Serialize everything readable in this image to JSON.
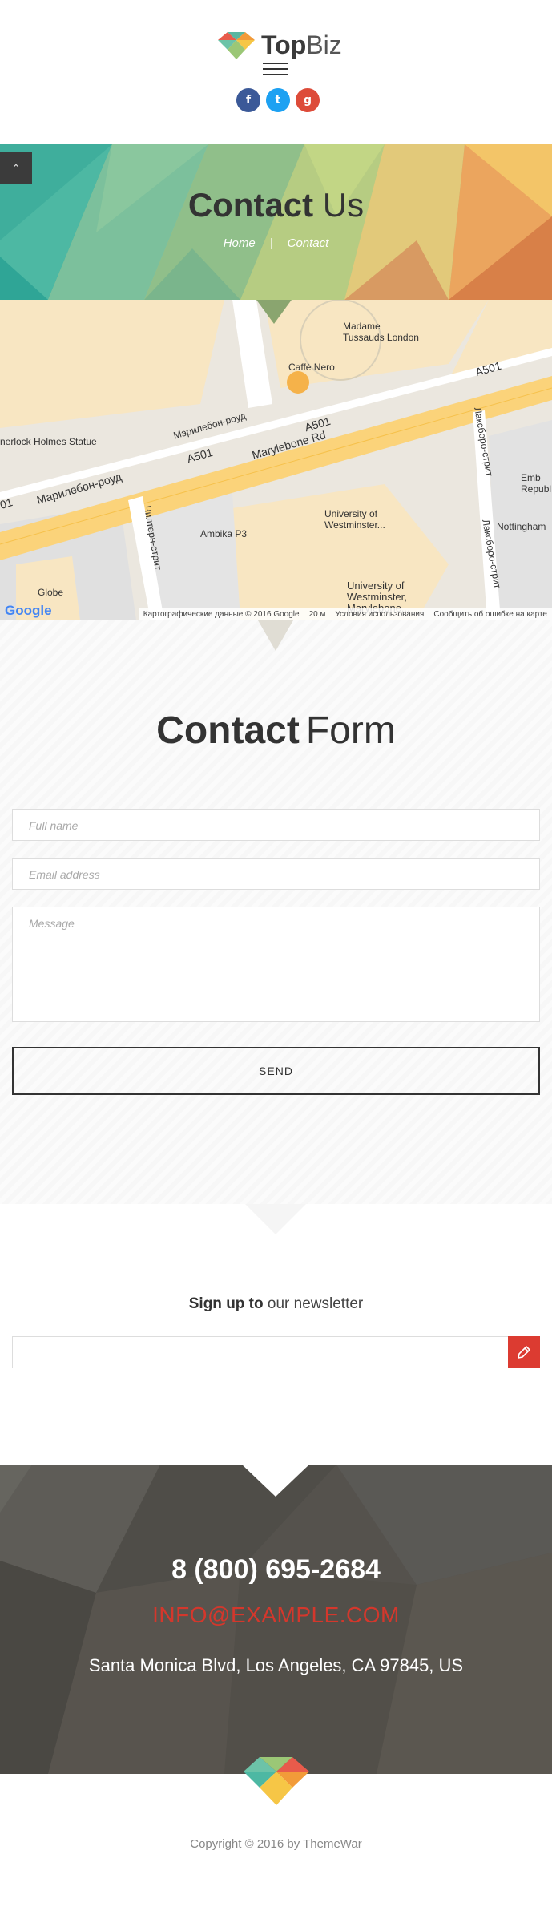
{
  "header": {
    "logo_bold": "Top",
    "logo_light": "Biz",
    "menu_icon": "hamburger-icon",
    "socials": [
      {
        "name": "facebook",
        "glyph": "f",
        "color": "#3b5998"
      },
      {
        "name": "twitter",
        "glyph": "t",
        "color": "#1da1f2"
      },
      {
        "name": "google-plus",
        "glyph": "g",
        "color": "#dd4b39"
      }
    ]
  },
  "hero": {
    "back_to_top_glyph": "⌃",
    "title_bold": "Contact",
    "title_light": "Us",
    "breadcrumb": {
      "home": "Home",
      "separator": "|",
      "current": "Contact"
    }
  },
  "map": {
    "labels": {
      "tussauds": "Madame Tussauds London",
      "caffe": "Caffè Nero",
      "marylebone_road_ru": "Мэрилебон-роуд",
      "a501_1": "A501",
      "a501_2": "A501",
      "a501_3": "A501",
      "a501_4": "01",
      "marylebone_rd": "Marylebone Rd",
      "marylebone_road_ru2": "Марилебон-роуд",
      "holmes": "nerlock Holmes Statue",
      "chiltern": "Чилтерн-стрит",
      "ambika": "Ambika P3",
      "uow1": "University of Westminster...",
      "uow2": "University of Westminster, Marylebone...",
      "luxborough": "Лаксборо-стрит",
      "luxborough2": "Лаксборо-стрит",
      "nottingham": "Nottingham",
      "embassy": "Emb Republ",
      "globe": "Globe"
    },
    "google": "Google",
    "attribution": "Картографические данные © 2016 Google",
    "scale": "20 м",
    "terms": "Условия использования",
    "report": "Сообщить об ошибке на карте"
  },
  "form": {
    "title_bold": "Contact",
    "title_light": "Form",
    "name_placeholder": "Full name",
    "email_placeholder": "Email address",
    "message_placeholder": "Message",
    "send_label": "SEND"
  },
  "newsletter": {
    "title_bold": "Sign up to",
    "title_light": "our newsletter",
    "submit_icon": "pencil-icon"
  },
  "contact_info": {
    "phone": "8 (800) 695-2684",
    "email": "INFO@EXAMPLE.COM",
    "address": "Santa Monica Blvd, Los Angeles, CA 97845, US"
  },
  "footer": {
    "copyright": "Copyright © 2016 by ThemeWar"
  },
  "colors": {
    "accent_red": "#dc3b31",
    "dark": "#333333"
  }
}
